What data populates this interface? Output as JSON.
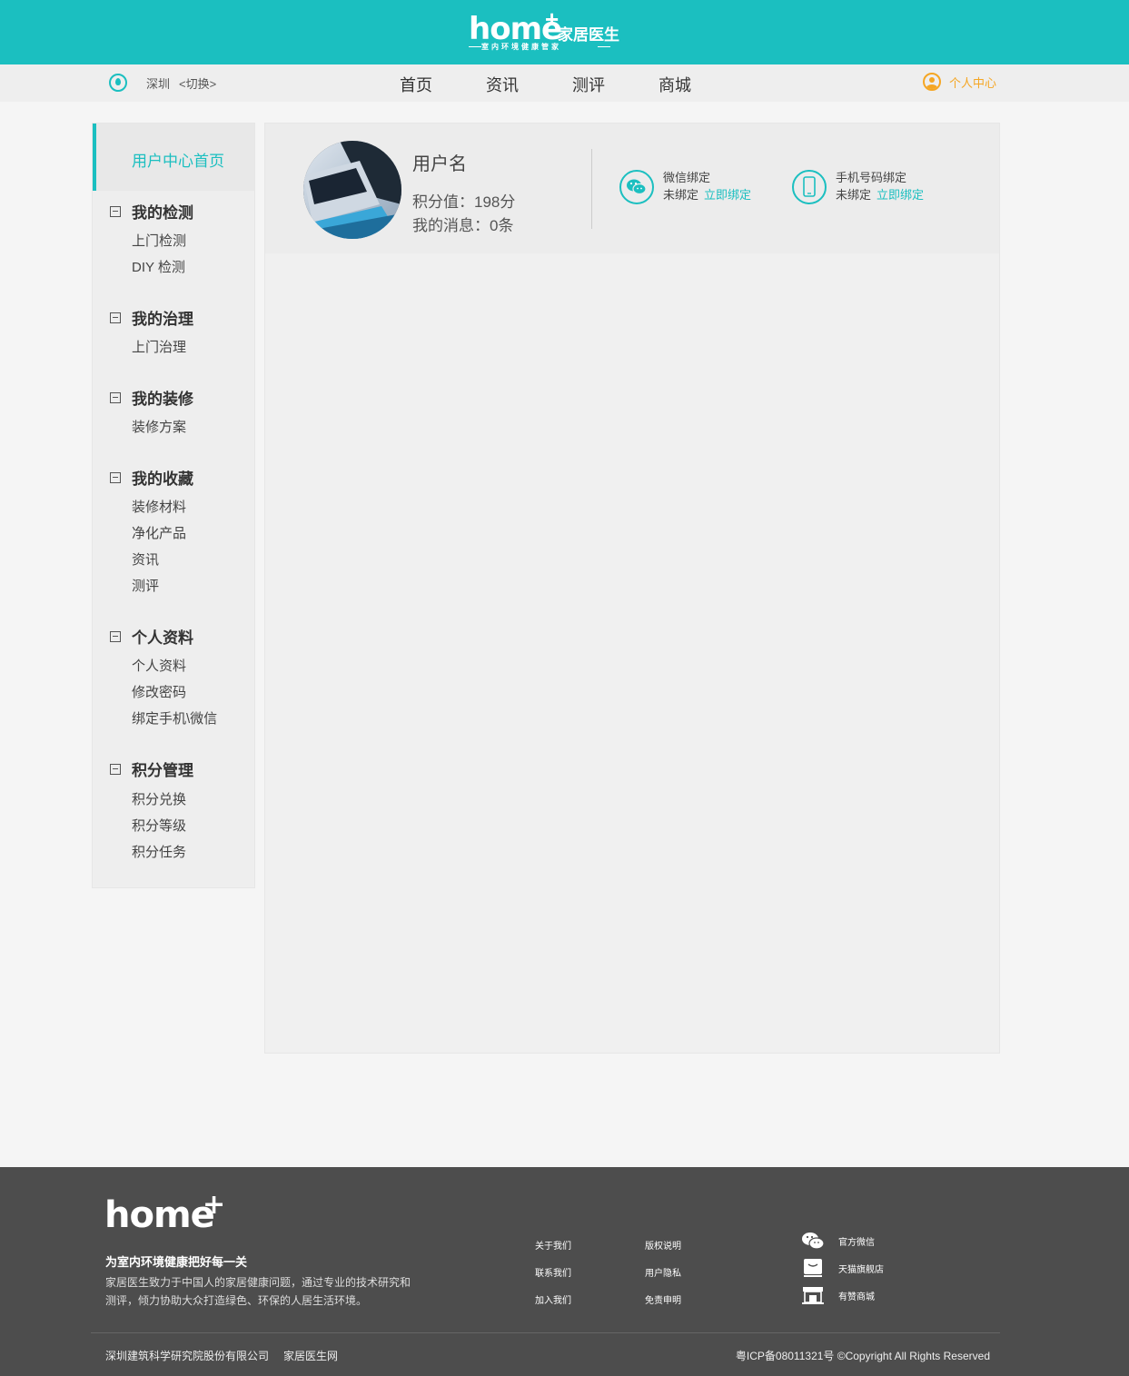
{
  "brand": {
    "word": "home",
    "plus": "+",
    "cn_name": "家居医生",
    "slogan": "室内环境健康管家"
  },
  "location": {
    "city": "深圳",
    "switch_label": "<切换>"
  },
  "nav": {
    "items": [
      "首页",
      "资讯",
      "测评",
      "商城"
    ],
    "personal_center": "个人中心"
  },
  "sidebar": {
    "home_label": "用户中心首页",
    "sections": [
      {
        "title": "我的检测",
        "items": [
          "上门检测",
          "DIY 检测"
        ]
      },
      {
        "title": "我的治理",
        "items": [
          "上门治理"
        ]
      },
      {
        "title": "我的装修",
        "items": [
          "装修方案"
        ]
      },
      {
        "title": "我的收藏",
        "items": [
          "装修材料",
          "净化产品",
          "资讯",
          "测评"
        ]
      },
      {
        "title": "个人资料",
        "items": [
          "个人资料",
          "修改密码",
          "绑定手机\\微信"
        ]
      },
      {
        "title": "积分管理",
        "items": [
          "积分兑换",
          "积分等级",
          "积分任务"
        ]
      }
    ]
  },
  "profile": {
    "username": "用户名",
    "points_label": "积分值：",
    "points_value": "198分",
    "messages_label": "我的消息：",
    "messages_value": "0条",
    "wechat": {
      "title": "微信绑定",
      "status": "未绑定",
      "action": "立即绑定"
    },
    "phone": {
      "title": "手机号码绑定",
      "status": "未绑定",
      "action": "立即绑定"
    }
  },
  "footer": {
    "logo_word": "home",
    "logo_plus": "+",
    "slogan": "为室内环境健康把好每一关",
    "desc": "家居医生致力于中国人的家居健康问题，通过专业的技术研究和测评，倾力协助大众打造绿色、环保的人居生活环境。",
    "links_col1": [
      "关于我们",
      "联系我们",
      "加入我们"
    ],
    "links_col2": [
      "版权说明",
      "用户隐私",
      "免责申明"
    ],
    "social": [
      {
        "icon": "wechat-icon",
        "label": "官方微信"
      },
      {
        "icon": "tmall-icon",
        "label": "天猫旗舰店"
      },
      {
        "icon": "store-icon",
        "label": "有赞商城"
      }
    ],
    "company": "深圳建筑科学研究院股份有限公司",
    "site": "家居医生网",
    "copyright": "粤ICP备08011321号 ©Copyright All Rights Reserved"
  },
  "colors": {
    "brand": "#1bbfc0",
    "accent": "#f5a623",
    "footer_bg": "#4d4d4d"
  }
}
